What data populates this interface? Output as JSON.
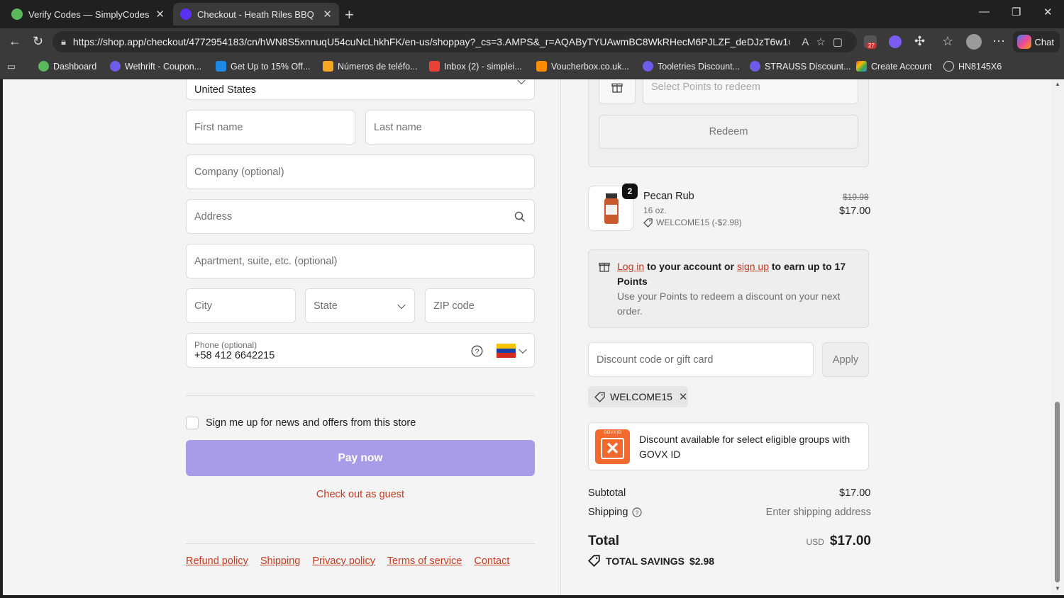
{
  "tabs": [
    {
      "title": "Verify Codes — SimplyCodes",
      "icon": "simplycodes-icon",
      "active": false
    },
    {
      "title": "Checkout - Heath Riles BBQ",
      "icon": "shop-icon",
      "active": true
    }
  ],
  "url": "https://shop.app/checkout/4772954183/cn/hWN8S5xnnuqU54cuNcLhkhFK/en-us/shoppay?_cs=3.AMPS&_r=AQAByTYUAwmBC8WkRHecM6PJLZF_deDJzT6w1u-IT2cq...",
  "chat_label": "Chat",
  "ext_badge": "27",
  "bookmarks": [
    {
      "label": "Dashboard"
    },
    {
      "label": "Wethrift - Coupon..."
    },
    {
      "label": "Get Up to 15% Off..."
    },
    {
      "label": "Números de teléfo..."
    },
    {
      "label": "Inbox (2) - simplei..."
    },
    {
      "label": "Voucherbox.co.uk..."
    },
    {
      "label": "Tooletries Discount..."
    },
    {
      "label": "STRAUSS Discount..."
    },
    {
      "label": "Create Account"
    },
    {
      "label": "HN8145X6"
    }
  ],
  "form": {
    "country": "United States",
    "first_name_placeholder": "First name",
    "last_name_placeholder": "Last name",
    "company_placeholder": "Company (optional)",
    "address_placeholder": "Address",
    "apartment_placeholder": "Apartment, suite, etc. (optional)",
    "city_placeholder": "City",
    "state_placeholder": "State",
    "zip_placeholder": "ZIP code",
    "phone_label": "Phone (optional)",
    "phone_value": "+58 412 6642215",
    "newsletter_label": "Sign me up for news and offers from this store",
    "pay_now": "Pay now",
    "guest_checkout": "Check out as guest"
  },
  "footer_links": [
    "Refund policy",
    "Shipping",
    "Privacy policy",
    "Terms of service",
    "Contact"
  ],
  "points": {
    "select_placeholder": "Select Points to redeem",
    "redeem_label": "Redeem"
  },
  "product": {
    "quantity": "2",
    "name": "Pecan Rub",
    "variant": "16 oz.",
    "discount": "WELCOME15 (-$2.98)",
    "original_price": "$19.98",
    "price": "$17.00"
  },
  "rewards": {
    "login": "Log in",
    "to_account_or": " to your account or ",
    "signup": "sign up",
    "earn": " to earn up to 17 Points",
    "description": "Use your Points to redeem a discount on your next order."
  },
  "discount": {
    "placeholder": "Discount code or gift card",
    "apply": "Apply",
    "applied_code": "WELCOME15"
  },
  "govx": {
    "logo_text": "GOVX ID",
    "text": "Discount available for select eligible groups with GOVX ID"
  },
  "summary": {
    "subtotal_label": "Subtotal",
    "subtotal": "$17.00",
    "shipping_label": "Shipping",
    "shipping_value": "Enter shipping address",
    "total_label": "Total",
    "currency": "USD",
    "total": "$17.00",
    "savings_label": "TOTAL SAVINGS",
    "savings": "$2.98"
  },
  "colors": {
    "pay_button": "#a99be8",
    "accent_red": "#c23b22",
    "govx_orange": "#f26a2e"
  }
}
